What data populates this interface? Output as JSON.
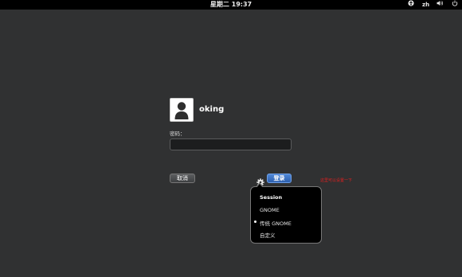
{
  "topbar": {
    "clock": "星期二 19:37",
    "language": "zh",
    "icons": [
      "accessibility-icon",
      "volume-icon",
      "power-icon"
    ]
  },
  "login": {
    "username": "oking",
    "password_label": "密码：",
    "password_value": "",
    "cancel_label": "取消",
    "login_label": "登录"
  },
  "annotation": "这里可以设置一下",
  "session_menu": {
    "title": "Session",
    "items": [
      {
        "label": "GNOME",
        "selected": false
      },
      {
        "label": "传统 GNOME",
        "selected": true
      },
      {
        "label": "自定义",
        "selected": false
      }
    ]
  },
  "colors": {
    "background": "#303132",
    "login_button": "#3a6fc0",
    "annotation": "#e02020"
  }
}
